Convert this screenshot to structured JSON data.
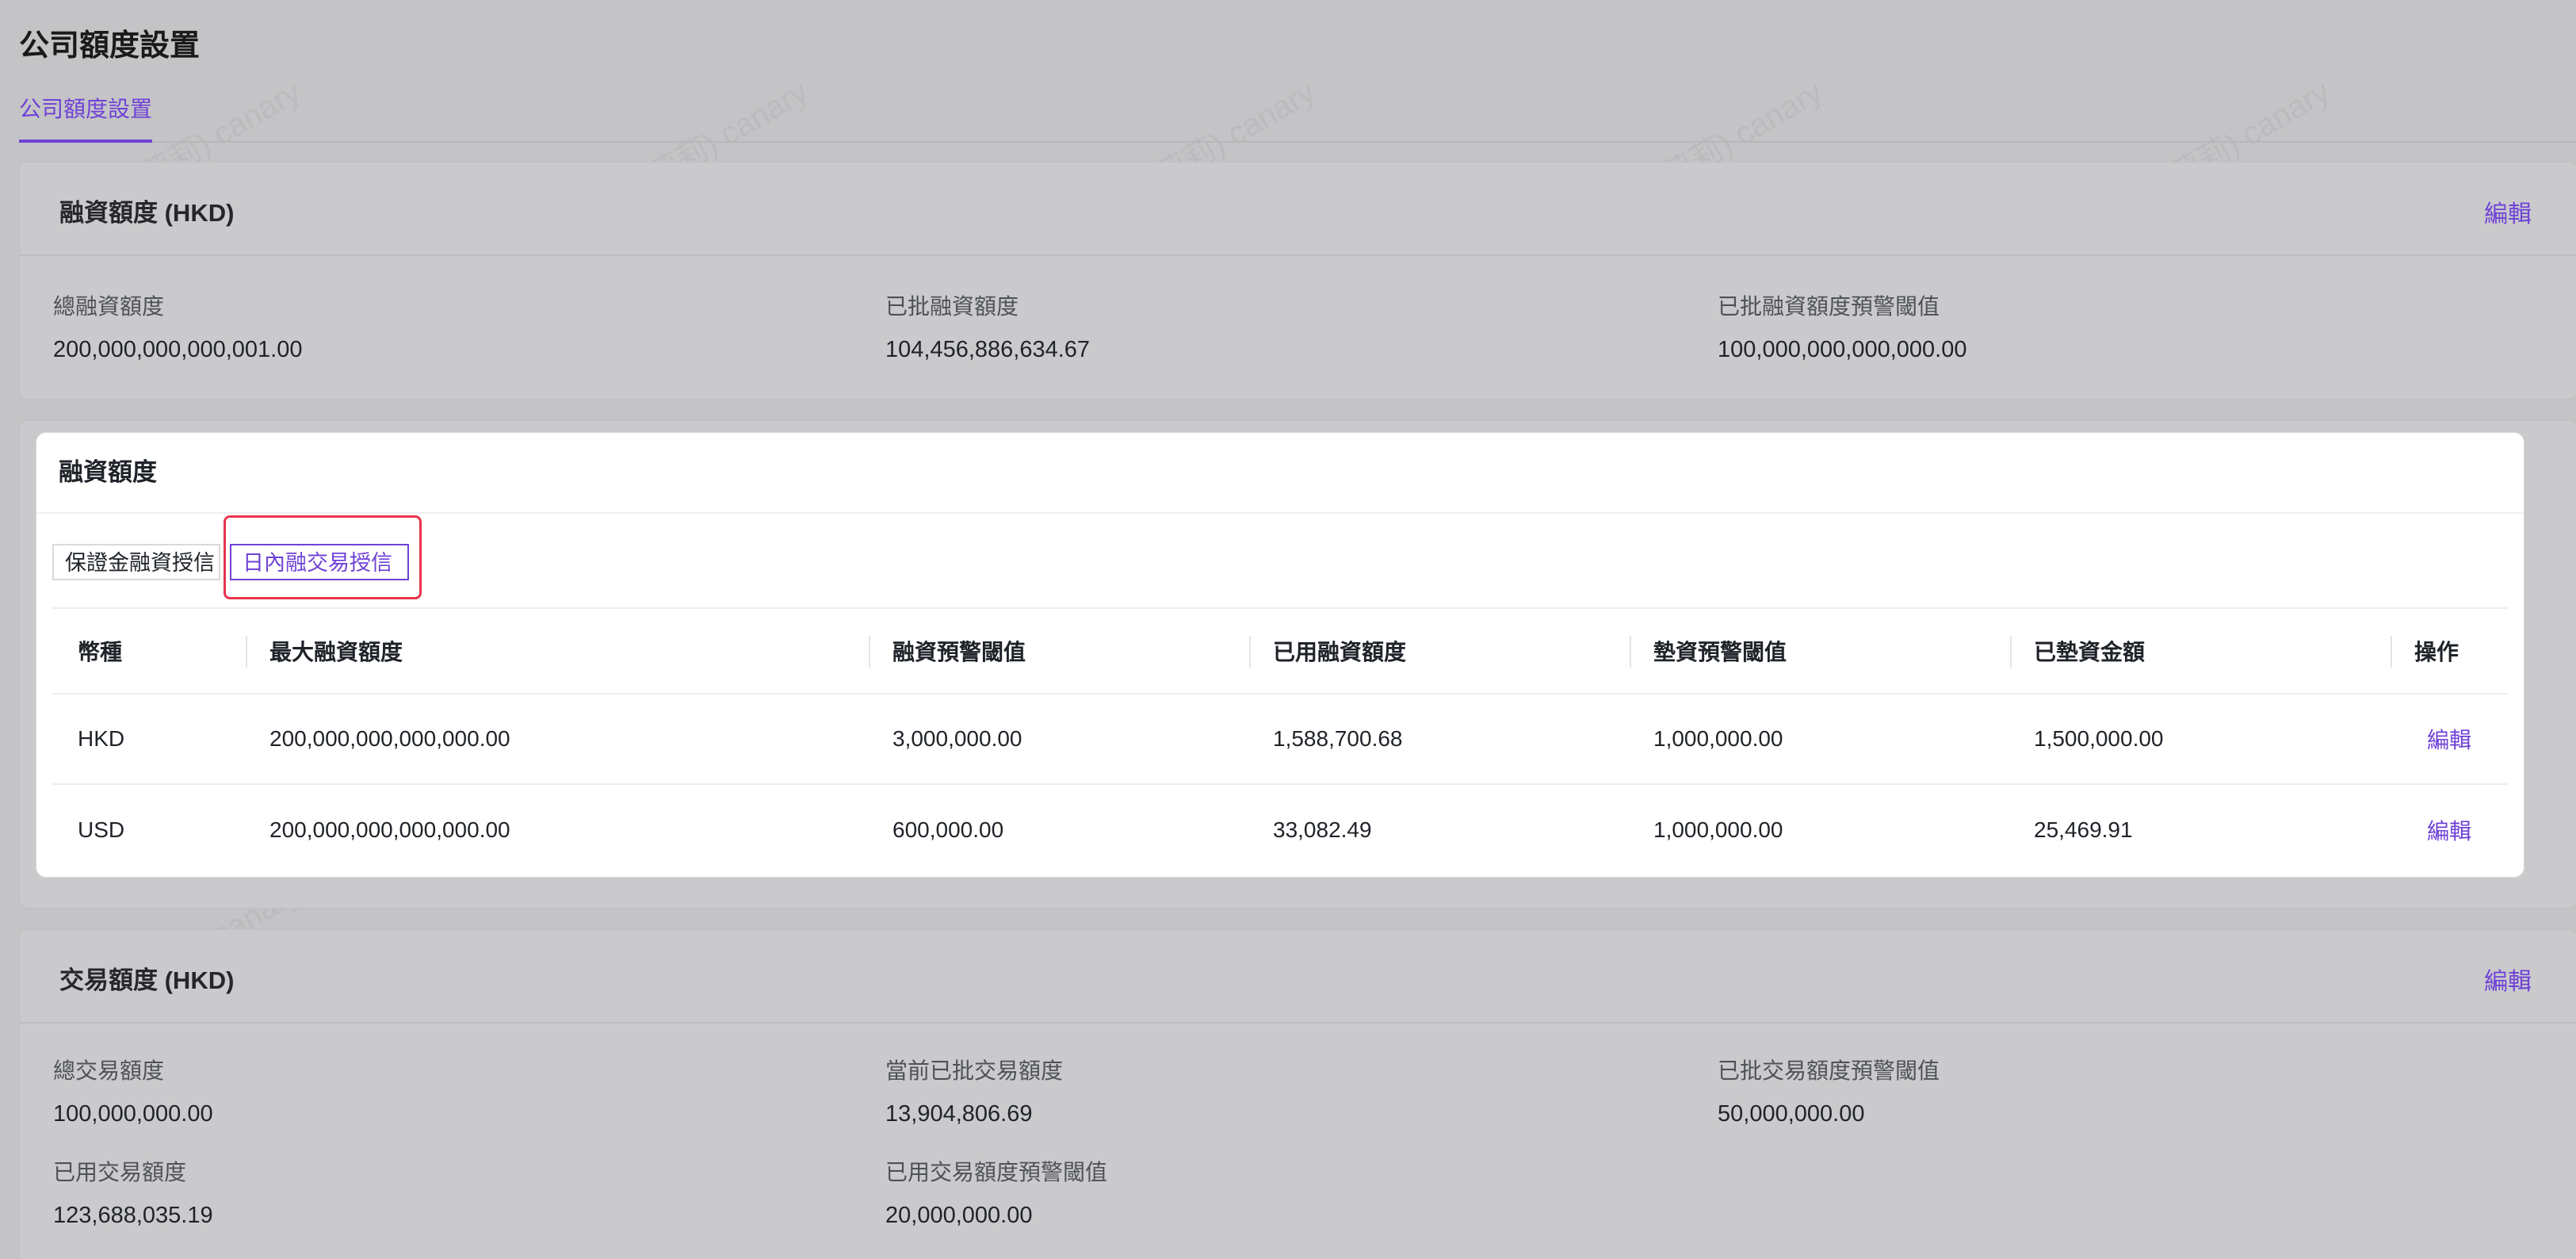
{
  "page": {
    "title": "公司額度設置"
  },
  "tabs": [
    {
      "label": "公司額度設置",
      "active": true
    }
  ],
  "financing_card": {
    "title": "融資額度 (HKD)",
    "edit_label": "編輯",
    "fields": [
      {
        "label": "總融資額度",
        "value": "200,000,000,000,001.00"
      },
      {
        "label": "已批融資額度",
        "value": "104,456,886,634.67"
      },
      {
        "label": "已批融資額度預警閾值",
        "value": "100,000,000,000,000.00"
      }
    ]
  },
  "panel": {
    "title": "融資額度",
    "subtabs": [
      {
        "label": "保證金融資授信",
        "active": false
      },
      {
        "label": "日內融交易授信",
        "active": true
      }
    ],
    "columns": [
      "幣種",
      "最大融資額度",
      "融資預警閾值",
      "已用融資額度",
      "墊資預警閾值",
      "已墊資金額",
      "操作"
    ],
    "rows": [
      {
        "currency": "HKD",
        "max": "200,000,000,000,000.00",
        "warn": "3,000,000.00",
        "used": "1,588,700.68",
        "advance_warn": "1,000,000.00",
        "advanced": "1,500,000.00",
        "action": "編輯"
      },
      {
        "currency": "USD",
        "max": "200,000,000,000,000.00",
        "warn": "600,000.00",
        "used": "33,082.49",
        "advance_warn": "1,000,000.00",
        "advanced": "25,469.91",
        "action": "編輯"
      }
    ]
  },
  "trading_card": {
    "title": "交易額度 (HKD)",
    "edit_label": "編輯",
    "fields": [
      {
        "label": "總交易額度",
        "value": "100,000,000.00"
      },
      {
        "label": "當前已批交易額度",
        "value": "13,904,806.69"
      },
      {
        "label": "已批交易額度預警閾值",
        "value": "50,000,000.00"
      },
      {
        "label": "已用交易額度",
        "value": "123,688,035.19"
      },
      {
        "label": "已用交易額度預警閾值",
        "value": "20,000,000.00"
      }
    ]
  },
  "watermark": {
    "text": "千鸟(宋莉莉) canary"
  },
  "colors": {
    "accent": "#6f42d6",
    "highlight": "#e8344f",
    "overlay": "#c4c4c6"
  }
}
